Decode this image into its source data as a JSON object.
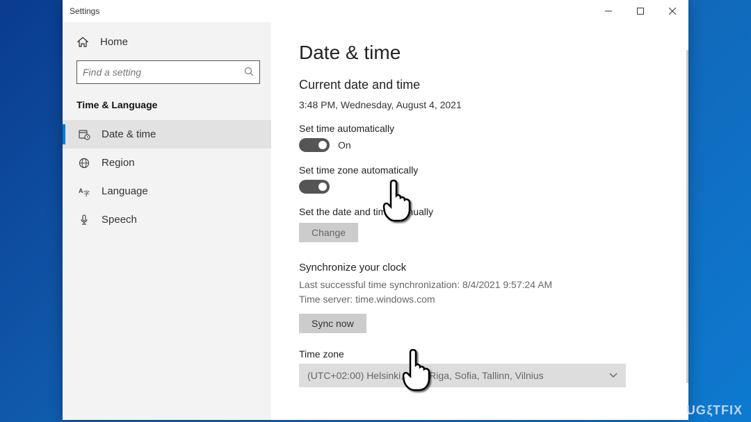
{
  "titlebar": {
    "title": "Settings"
  },
  "sidebar": {
    "home_label": "Home",
    "search_placeholder": "Find a setting",
    "section_title": "Time & Language",
    "items": [
      {
        "label": "Date & time"
      },
      {
        "label": "Region"
      },
      {
        "label": "Language"
      },
      {
        "label": "Speech"
      }
    ]
  },
  "main": {
    "heading": "Date & time",
    "subheading": "Current date and time",
    "current_time": "3:48 PM, Wednesday, August 4, 2021",
    "set_time_auto": {
      "label": "Set time automatically",
      "state": "On"
    },
    "set_zone_auto": {
      "label": "Set time zone automatically",
      "state": ""
    },
    "manual": {
      "label": "Set the date and time manually",
      "button": "Change"
    },
    "sync": {
      "heading": "Synchronize your clock",
      "last": "Last successful time synchronization: 8/4/2021 9:57:24 AM",
      "server": "Time server: time.windows.com",
      "button": "Sync now"
    },
    "timezone": {
      "label": "Time zone",
      "value": "(UTC+02:00) Helsinki, Kyiv, Riga, Sofia, Tallinn, Vilnius"
    }
  },
  "watermark": "UGETFIX"
}
